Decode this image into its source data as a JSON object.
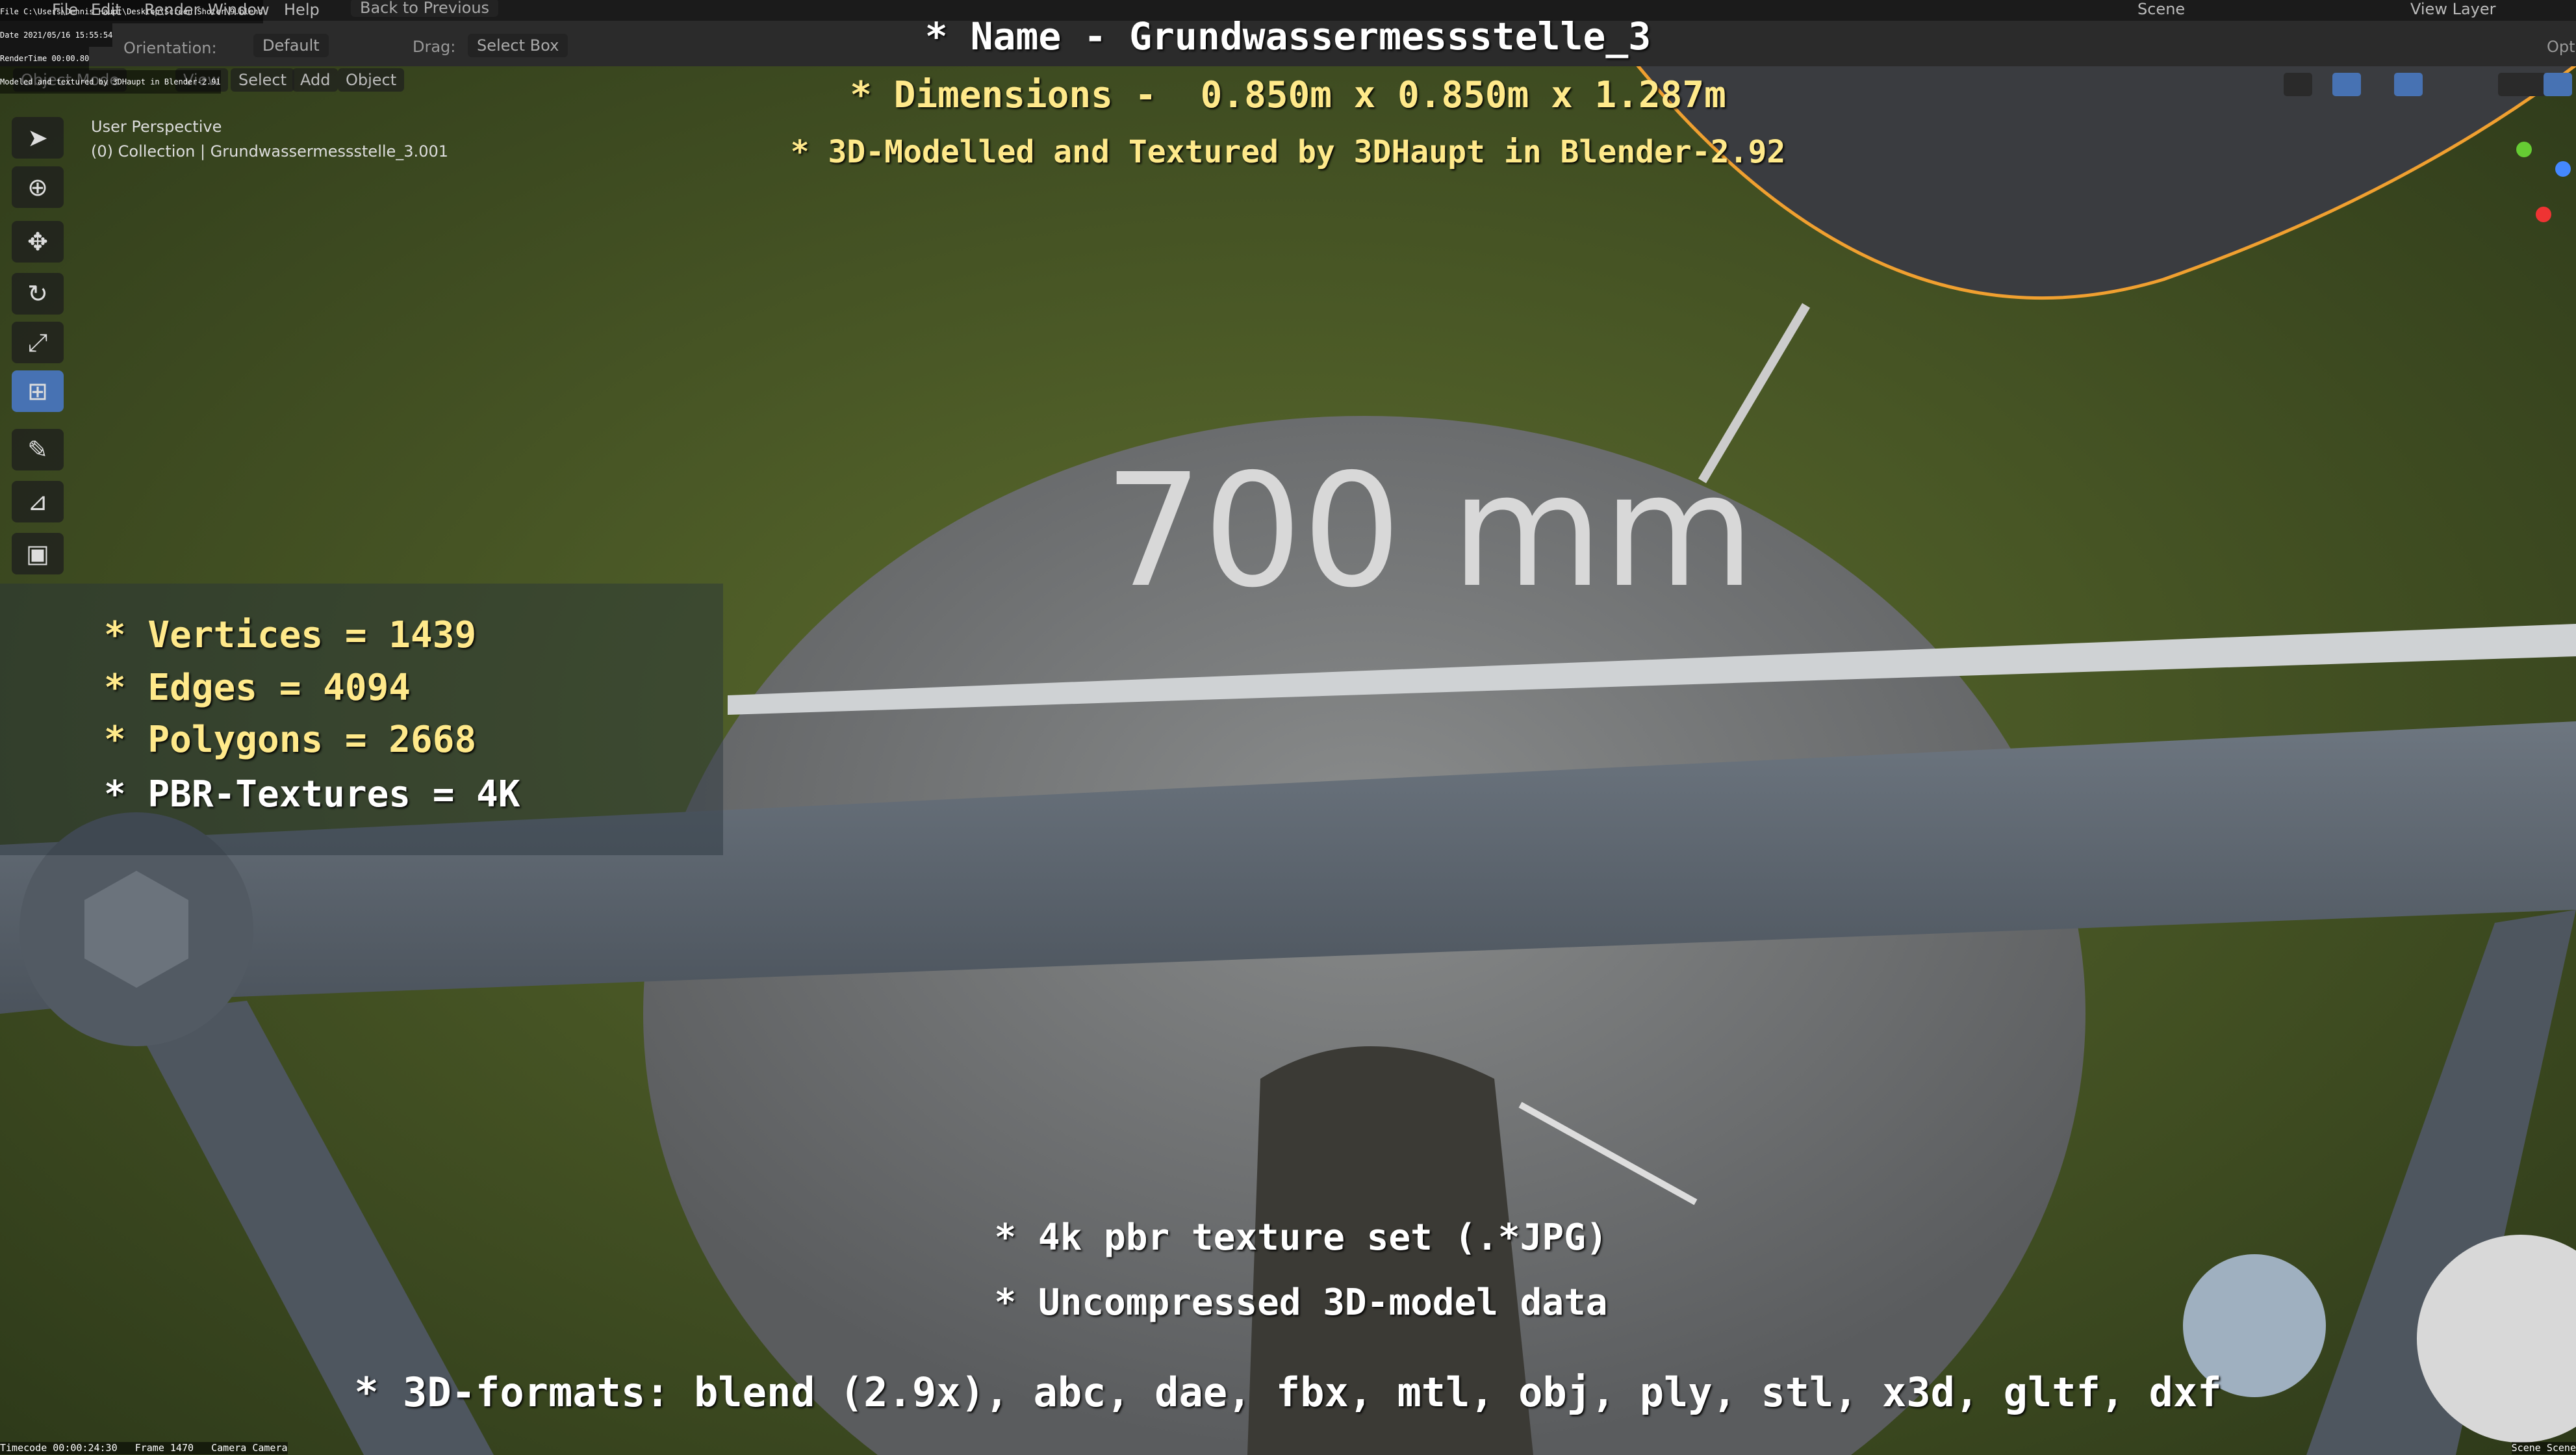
{
  "menubar": {
    "items": [
      "File",
      "Edit",
      "Render",
      "Window",
      "Help"
    ],
    "back_button": "Back to Previous",
    "scene": "Scene",
    "view_layer": "View Layer"
  },
  "header": {
    "orientation": "Orientation:",
    "pivot": "Default",
    "drag_label": "Drag:",
    "drag_value": "Select Box",
    "options": "Opt"
  },
  "viewport_menu": {
    "mode": "Object Mode",
    "items": [
      "View",
      "Select",
      "Add",
      "Object"
    ]
  },
  "viewport_info": {
    "perspective": "User Perspective",
    "collection": "(0) Collection | Grundwassermessstelle_3.001"
  },
  "render_meta": [
    "File C:\\Users\\Dennis Haupt\\Desktop\\Screen Shoter\\9.blend",
    "Date 2021/05/16 15:55:54",
    "RenderTime 00:00.80",
    "Modeled and textured by 3DHaupt in Blender-2.91"
  ],
  "footer_meta": {
    "left": "Timecode 00:00:24:30   Frame 1470   Camera Camera",
    "right": "Scene Scene"
  },
  "overlay": {
    "name": "* Name - Grundwassermessstelle_3",
    "dimensions": "* Dimensions -  0.850m x 0.850m x 1.287m",
    "credit": "* 3D-Modelled and Textured by 3DHaupt in Blender-2.92",
    "stats": [
      "* Vertices = 1439",
      "* Edges = 4094",
      "* Polygons = 2668",
      "* PBR-Textures = 4K"
    ],
    "texture": "* 4k pbr texture set (.*JPG)",
    "uncompressed": "* Uncompressed 3D-model data",
    "formats": "* 3D-formats: blend (2.9x), abc, dae, fbx, mtl, obj, ply, stl, x3d, gltf, dxf"
  },
  "scene_label": "700 mm",
  "colors": {
    "accent": "#4772b3",
    "yellow": "#ffe98a",
    "selection": "#f0a030"
  }
}
